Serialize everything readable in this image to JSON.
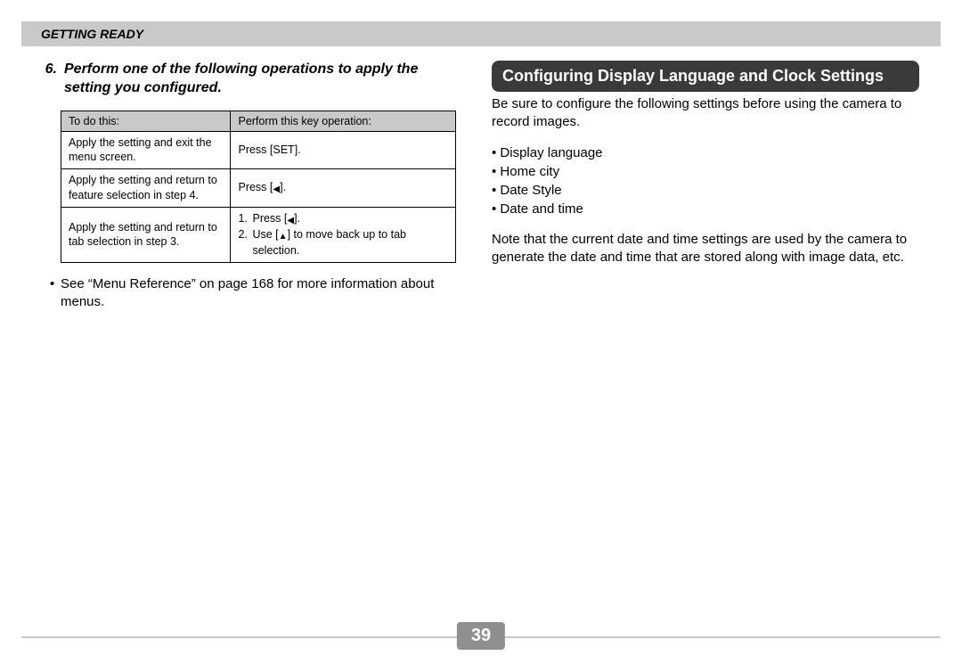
{
  "header": "Getting Ready",
  "page_number": "39",
  "left": {
    "step_number": "6.",
    "step_text": "Perform one of the following operations to apply the setting you configured.",
    "table": {
      "headers": [
        "To do this:",
        "Perform this key operation:"
      ],
      "rows": [
        {
          "todo": "Apply the setting and exit the menu screen.",
          "op_plain": "Press [SET]."
        },
        {
          "todo": "Apply the setting and return to feature selection in step 4.",
          "op_left": "Press ["
        },
        {
          "todo": "Apply the setting and return to tab selection in step 3.",
          "op_steps": {
            "s1a": "Press [",
            "s1b": "].",
            "s2a": "Use [",
            "s2b": "] to move back up to tab selection."
          }
        }
      ]
    },
    "note": "See “Menu Reference” on page 168 for more information about menus."
  },
  "right": {
    "banner": "Configuring Display Language and Clock Settings",
    "intro": "Be sure to configure the following settings before using the camera to record images.",
    "bullets": [
      "Display language",
      "Home city",
      "Date Style",
      "Date and time"
    ],
    "note2": "Note that the current date and time settings are used by the camera to generate the date and time that are stored along with image data, etc."
  }
}
